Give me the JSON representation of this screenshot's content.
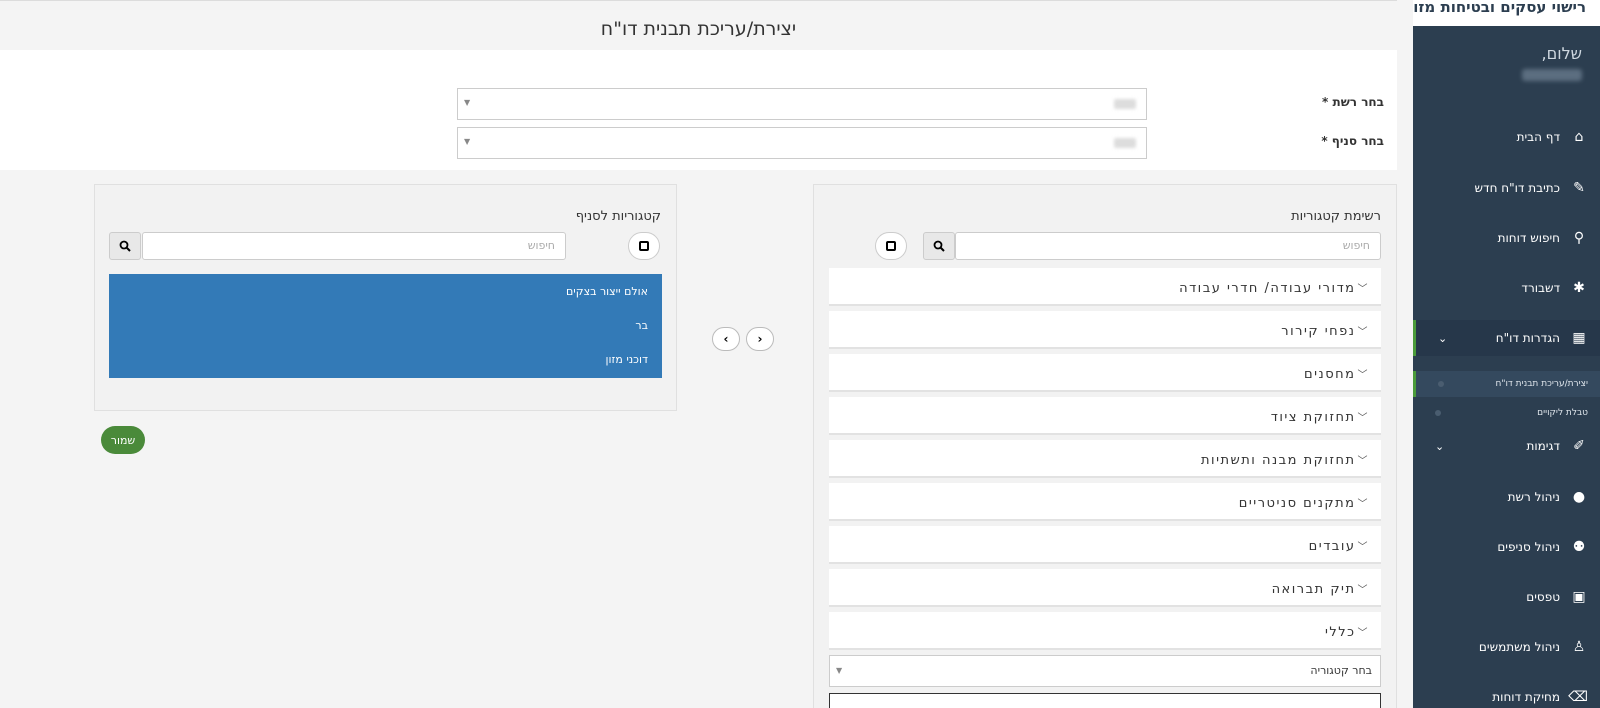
{
  "app": {
    "brand": "רישוי עסקים ובטיחות מזון"
  },
  "sidebar": {
    "greeting": "שלום,",
    "items": [
      {
        "label": "דף הבית",
        "icon": "home-icon"
      },
      {
        "label": "כתיבת דו\"ח חדש",
        "icon": "pencil-icon"
      },
      {
        "label": "חיפוש דוחות",
        "icon": "search-icon"
      },
      {
        "label": "דשבורד",
        "icon": "bug-icon"
      },
      {
        "label": "הגדרות דו\"ח",
        "icon": "table-icon"
      },
      {
        "label": "דגימות",
        "icon": "eyedropper-icon"
      },
      {
        "label": "ניהול רשת",
        "icon": "user-icon"
      },
      {
        "label": "ניהול סניפים",
        "icon": "users-icon"
      },
      {
        "label": "טפסים",
        "icon": "image-icon"
      },
      {
        "label": "ניהול משתמשים",
        "icon": "person-icon"
      },
      {
        "label": "מחיקת דוחות",
        "icon": "eraser-icon"
      }
    ],
    "subitems": [
      {
        "label": "יצירת/עריכת תבנית דו\"ח"
      },
      {
        "label": "טבלת ליקויים"
      }
    ]
  },
  "page": {
    "title": "יצירת/עריכת תבנית דו\"ח"
  },
  "form": {
    "chain_label": "בחר רשת *",
    "branch_label": "בחר סניף *"
  },
  "categories_panel": {
    "title": "רשימת קטגוריות",
    "search_placeholder": "חיפוש",
    "items": [
      "מדורי עבודה/ חדרי עבודה",
      "נפחי קירור",
      "מחסנים",
      "תחזוקת ציוד",
      "תחזוקת מבנה ותשתיות",
      "מתקנים סניטריים",
      "עובדים",
      "תיק תברואה",
      "כללי"
    ],
    "select_category": "בחר קטגוריה"
  },
  "branch_panel": {
    "title": "קטגוריות לסניף",
    "search_placeholder": "חיפוש",
    "items": [
      "אולם ייצור בצקים",
      "בר",
      "דוכני מזון"
    ]
  },
  "actions": {
    "save": "שמור"
  },
  "colors": {
    "sidebar": "#2c3e50",
    "selected_list": "#337ab7",
    "save_button": "#4a8a3a"
  }
}
